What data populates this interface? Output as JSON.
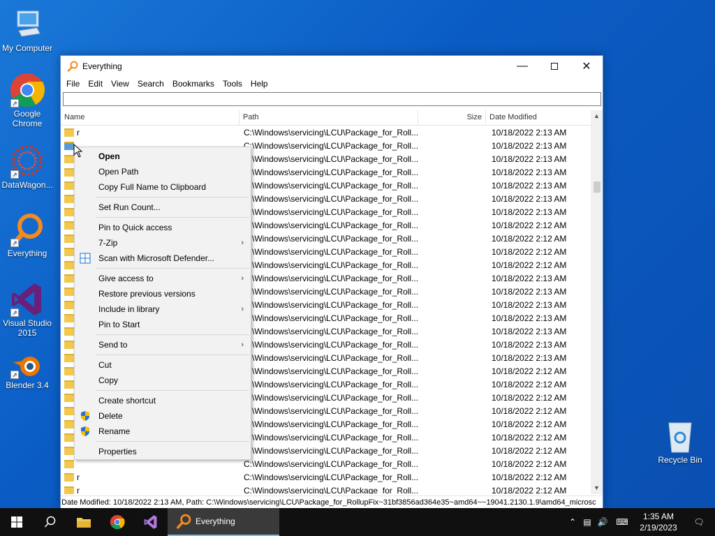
{
  "desktop": {
    "icons": [
      {
        "label": "My Computer",
        "icon": "monitor-icon"
      },
      {
        "label": "Google Chrome",
        "icon": "chrome-icon"
      },
      {
        "label": "DataWagon...",
        "icon": "datawagon-icon"
      },
      {
        "label": "Everything",
        "icon": "everything-icon"
      },
      {
        "label": "Visual Studio 2015",
        "icon": "visual-studio-icon"
      },
      {
        "label": "Blender 3.4",
        "icon": "blender-icon"
      },
      {
        "label": "Recycle Bin",
        "icon": "recycle-bin-icon"
      }
    ]
  },
  "window": {
    "title": "Everything",
    "menu": [
      "File",
      "Edit",
      "View",
      "Search",
      "Bookmarks",
      "Tools",
      "Help"
    ],
    "search_value": "",
    "columns": {
      "name": "Name",
      "path": "Path",
      "size": "Size",
      "date": "Date Modified"
    },
    "rows": [
      {
        "name": "r",
        "path": "C:\\Windows\\servicing\\LCU\\Package_for_Roll...",
        "date": "10/18/2022 2:13 AM"
      },
      {
        "name": "",
        "path": "C:\\Windows\\servicing\\LCU\\Package_for_Roll...",
        "date": "10/18/2022 2:13 AM"
      },
      {
        "name": "",
        "path": "C:\\Windows\\servicing\\LCU\\Package_for_Roll...",
        "date": "10/18/2022 2:13 AM"
      },
      {
        "name": "",
        "path": "C:\\Windows\\servicing\\LCU\\Package_for_Roll...",
        "date": "10/18/2022 2:13 AM"
      },
      {
        "name": "",
        "path": "C:\\Windows\\servicing\\LCU\\Package_for_Roll...",
        "date": "10/18/2022 2:13 AM"
      },
      {
        "name": "",
        "path": "C:\\Windows\\servicing\\LCU\\Package_for_Roll...",
        "date": "10/18/2022 2:13 AM"
      },
      {
        "name": "",
        "path": "C:\\Windows\\servicing\\LCU\\Package_for_Roll...",
        "date": "10/18/2022 2:13 AM"
      },
      {
        "name": "",
        "path": "C:\\Windows\\servicing\\LCU\\Package_for_Roll...",
        "date": "10/18/2022 2:12 AM"
      },
      {
        "name": "",
        "path": "C:\\Windows\\servicing\\LCU\\Package_for_Roll...",
        "date": "10/18/2022 2:12 AM"
      },
      {
        "name": "",
        "path": "C:\\Windows\\servicing\\LCU\\Package_for_Roll...",
        "date": "10/18/2022 2:12 AM"
      },
      {
        "name": "",
        "path": "C:\\Windows\\servicing\\LCU\\Package_for_Roll...",
        "date": "10/18/2022 2:12 AM"
      },
      {
        "name": "",
        "path": "C:\\Windows\\servicing\\LCU\\Package_for_Roll...",
        "date": "10/18/2022 2:13 AM"
      },
      {
        "name": "",
        "path": "C:\\Windows\\servicing\\LCU\\Package_for_Roll...",
        "date": "10/18/2022 2:13 AM"
      },
      {
        "name": "",
        "path": "C:\\Windows\\servicing\\LCU\\Package_for_Roll...",
        "date": "10/18/2022 2:13 AM"
      },
      {
        "name": "",
        "path": "C:\\Windows\\servicing\\LCU\\Package_for_Roll...",
        "date": "10/18/2022 2:13 AM"
      },
      {
        "name": "",
        "path": "C:\\Windows\\servicing\\LCU\\Package_for_Roll...",
        "date": "10/18/2022 2:13 AM"
      },
      {
        "name": "",
        "path": "C:\\Windows\\servicing\\LCU\\Package_for_Roll...",
        "date": "10/18/2022 2:13 AM"
      },
      {
        "name": "",
        "path": "C:\\Windows\\servicing\\LCU\\Package_for_Roll...",
        "date": "10/18/2022 2:13 AM"
      },
      {
        "name": "",
        "path": "C:\\Windows\\servicing\\LCU\\Package_for_Roll...",
        "date": "10/18/2022 2:12 AM"
      },
      {
        "name": "",
        "path": "C:\\Windows\\servicing\\LCU\\Package_for_Roll...",
        "date": "10/18/2022 2:12 AM"
      },
      {
        "name": "",
        "path": "C:\\Windows\\servicing\\LCU\\Package_for_Roll...",
        "date": "10/18/2022 2:12 AM"
      },
      {
        "name": "",
        "path": "C:\\Windows\\servicing\\LCU\\Package_for_Roll...",
        "date": "10/18/2022 2:12 AM"
      },
      {
        "name": "",
        "path": "C:\\Windows\\servicing\\LCU\\Package_for_Roll...",
        "date": "10/18/2022 2:12 AM"
      },
      {
        "name": "",
        "path": "C:\\Windows\\servicing\\LCU\\Package_for_Roll...",
        "date": "10/18/2022 2:12 AM"
      },
      {
        "name": "",
        "path": "C:\\Windows\\servicing\\LCU\\Package_for_Roll...",
        "date": "10/18/2022 2:12 AM"
      },
      {
        "name": "",
        "path": "C:\\Windows\\servicing\\LCU\\Package_for_Roll...",
        "date": "10/18/2022 2:12 AM"
      },
      {
        "name": "r",
        "path": "C:\\Windows\\servicing\\LCU\\Package_for_Roll...",
        "date": "10/18/2022 2:12 AM"
      },
      {
        "name": "r",
        "path": "C:\\Windows\\servicing\\LCU\\Package_for_Roll...",
        "date": "10/18/2022 2:12 AM"
      },
      {
        "name": "r",
        "path": "C:\\Windows\\servicing\\LCU\\Package_for_Roll...",
        "date": "10/18/2022 2:12 AM"
      }
    ],
    "status": "Date Modified: 10/18/2022 2:13 AM, Path: C:\\Windows\\servicing\\LCU\\Package_for_RollupFix~31bf3856ad364e35~amd64~~19041.2130.1.9\\amd64_microsc"
  },
  "context_menu": {
    "groups": [
      [
        {
          "label": "Open",
          "bold": true
        },
        {
          "label": "Open Path"
        },
        {
          "label": "Copy Full Name to Clipboard"
        }
      ],
      [
        {
          "label": "Set Run Count..."
        }
      ],
      [
        {
          "label": "Pin to Quick access"
        },
        {
          "label": "7-Zip",
          "submenu": true
        },
        {
          "label": "Scan with Microsoft Defender...",
          "icon": "defender-icon"
        }
      ],
      [
        {
          "label": "Give access to",
          "submenu": true
        },
        {
          "label": "Restore previous versions"
        },
        {
          "label": "Include in library",
          "submenu": true
        },
        {
          "label": "Pin to Start"
        }
      ],
      [
        {
          "label": "Send to",
          "submenu": true
        }
      ],
      [
        {
          "label": "Cut"
        },
        {
          "label": "Copy"
        }
      ],
      [
        {
          "label": "Create shortcut"
        },
        {
          "label": "Delete",
          "icon": "uac-shield-icon"
        },
        {
          "label": "Rename",
          "icon": "uac-shield-icon"
        }
      ],
      [
        {
          "label": "Properties"
        }
      ]
    ]
  },
  "taskbar": {
    "active_app": "Everything",
    "time": "1:35 AM",
    "date": "2/19/2023"
  },
  "colors": {
    "accent": "#0a5cc4",
    "taskbar": "#101010",
    "menu_bg": "#f2f2f2"
  }
}
